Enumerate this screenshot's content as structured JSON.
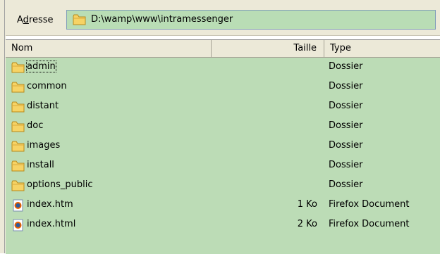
{
  "address": {
    "label_prefix": "A",
    "label_underlined": "d",
    "label_suffix": "resse",
    "path": "D:\\wamp\\www\\intramessenger"
  },
  "columns": {
    "name": "Nom",
    "size": "Taille",
    "type": "Type"
  },
  "files": [
    {
      "name": "admin",
      "size": "",
      "type": "Dossier",
      "icon": "folder-icon",
      "focused": true
    },
    {
      "name": "common",
      "size": "",
      "type": "Dossier",
      "icon": "folder-icon"
    },
    {
      "name": "distant",
      "size": "",
      "type": "Dossier",
      "icon": "folder-icon"
    },
    {
      "name": "doc",
      "size": "",
      "type": "Dossier",
      "icon": "folder-icon"
    },
    {
      "name": "images",
      "size": "",
      "type": "Dossier",
      "icon": "folder-icon"
    },
    {
      "name": "install",
      "size": "",
      "type": "Dossier",
      "icon": "folder-icon"
    },
    {
      "name": "options_public",
      "size": "",
      "type": "Dossier",
      "icon": "folder-icon"
    },
    {
      "name": "index.htm",
      "size": "1 Ko",
      "type": "Firefox Document",
      "icon": "firefox-document-icon"
    },
    {
      "name": "index.html",
      "size": "2 Ko",
      "type": "Firefox Document",
      "icon": "firefox-document-icon"
    }
  ],
  "colors": {
    "list_background": "#bcdcb6",
    "address_background": "#b9ddb5",
    "chrome": "#ece9d8"
  }
}
